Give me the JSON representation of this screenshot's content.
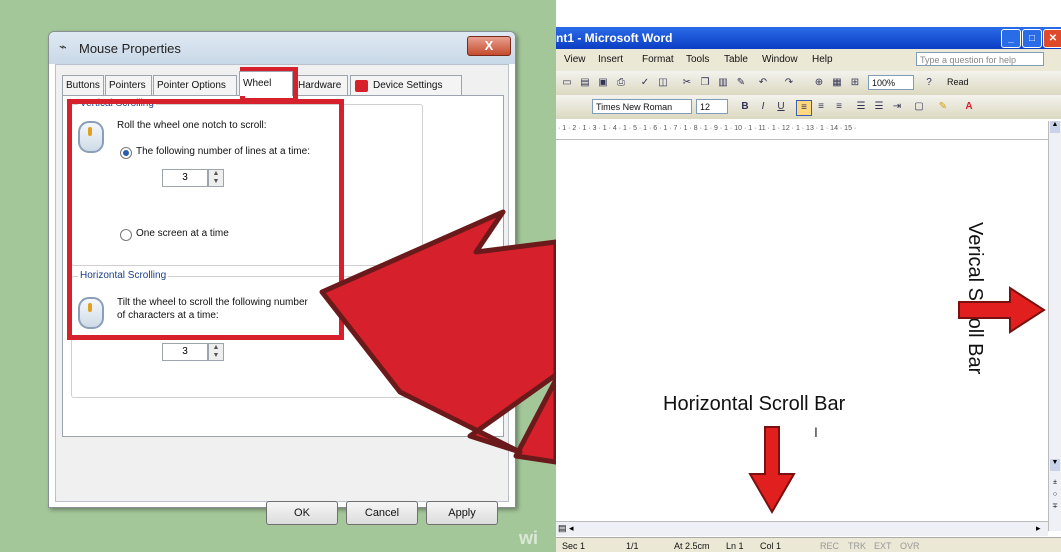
{
  "mouse_dialog": {
    "title": "Mouse Properties",
    "close_label": "X",
    "tabs": [
      "Buttons",
      "Pointers",
      "Pointer Options",
      "Wheel",
      "Hardware",
      "Device Settings"
    ],
    "selected_tab": "Wheel",
    "vertical": {
      "group_title": "Vertical Scrolling",
      "prompt": "Roll the wheel one notch to scroll:",
      "option_lines": "The following number of lines at a time:",
      "lines_value": "3",
      "option_screen": "One screen at a time"
    },
    "horizontal": {
      "group_title": "Horizontal Scrolling",
      "prompt_line1": "Tilt the wheel to scroll the following number",
      "prompt_line2": "of characters at a time:",
      "chars_value": "3"
    },
    "buttons": {
      "ok": "OK",
      "cancel": "Cancel",
      "apply": "Apply"
    }
  },
  "watermark": "wi",
  "word": {
    "title": "nt1 - Microsoft Word",
    "menu": [
      "View",
      "Insert",
      "Format",
      "Tools",
      "Table",
      "Window",
      "Help"
    ],
    "help_placeholder": "Type a question for help",
    "zoom": "100%",
    "read_label": "Read",
    "font_name": "Times New Roman",
    "font_size": "12",
    "ruler_text": "· 1 · 2 · 1 · 3 · 1 · 4 · 1 · 5 · 1 · 6 · 1 · 7 · 1 · 8 · 1 · 9 · 1 · 10 · 1 · 11 · 1 · 12 · 1 · 13 · 1 · 14 · 15 ·",
    "status": {
      "sec": "Sec 1",
      "page": "1/1",
      "at": "At 2.5cm",
      "ln": "Ln 1",
      "col": "Col 1",
      "rec": "REC",
      "trk": "TRK",
      "ext": "EXT",
      "ovr": "OVR"
    }
  },
  "annotations": {
    "vertical": "Verical Scroll Bar",
    "horizontal": "Horizontal Scroll Bar"
  },
  "colors": {
    "highlight_red": "#d6202c",
    "left_background": "#a4c79a",
    "word_titlebar": "#0b3ec4"
  }
}
